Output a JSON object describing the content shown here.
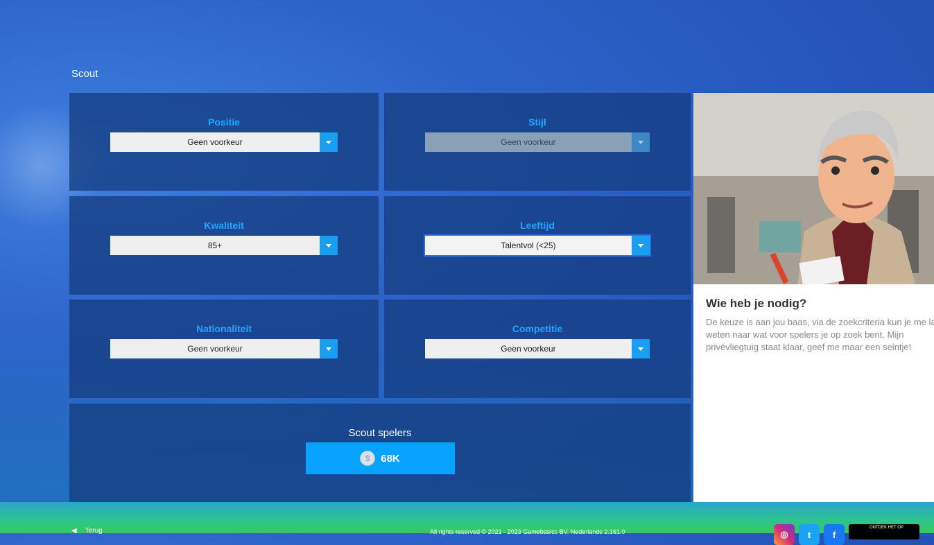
{
  "page": {
    "title": "Scout"
  },
  "filters": {
    "positie": {
      "label": "Positie",
      "value": "Geen voorkeur"
    },
    "stijl": {
      "label": "Stijl",
      "value": "Geen voorkeur"
    },
    "kwaliteit": {
      "label": "Kwaliteit",
      "value": "85+"
    },
    "leeftijd": {
      "label": "Leeftijd",
      "value": "Talentvol (<25)"
    },
    "nationaliteit": {
      "label": "Nationaliteit",
      "value": "Geen voorkeur"
    },
    "competitie": {
      "label": "Competitie",
      "value": "Geen voorkeur"
    }
  },
  "scout": {
    "label": "Scout spelers",
    "cost": "68K"
  },
  "side": {
    "title": "Wie heb je nodig?",
    "text": "De keuze is aan jou baas, via de zoekcriteria kun je me laten weten naar wat voor spelers je op zoek bent. Mijn privévliegtuig staat klaar, geef me maar een seintje!"
  },
  "footer": {
    "copyright": "All rights reserved © 2021 - 2023 Gamebasics BV. Nederlands 2.161.0",
    "back": "Terug",
    "store": "ONTDEK HET OP"
  },
  "colors": {
    "accent": "#1ea7ff",
    "button": "#08a3ff",
    "panel": "#163e82"
  }
}
